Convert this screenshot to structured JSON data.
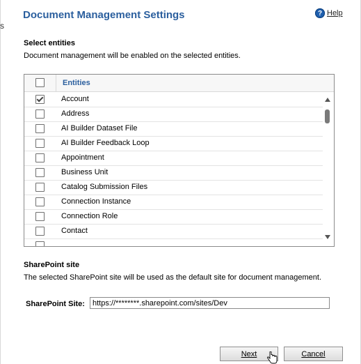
{
  "dialog": {
    "title": "Document Management Settings",
    "help_label": "Help",
    "help_icon_glyph": "?",
    "stray_char": "s"
  },
  "entities_section": {
    "heading": "Select entities",
    "description": "Document management will be enabled on the selected entities.",
    "column_header": "Entities",
    "rows": [
      {
        "label": "Account",
        "checked": true
      },
      {
        "label": "Address",
        "checked": false
      },
      {
        "label": "AI Builder Dataset File",
        "checked": false
      },
      {
        "label": "AI Builder Feedback Loop",
        "checked": false
      },
      {
        "label": "Appointment",
        "checked": false
      },
      {
        "label": "Business Unit",
        "checked": false
      },
      {
        "label": "Catalog Submission Files",
        "checked": false
      },
      {
        "label": "Connection Instance",
        "checked": false
      },
      {
        "label": "Connection Role",
        "checked": false
      },
      {
        "label": "Contact",
        "checked": false
      }
    ]
  },
  "sharepoint_section": {
    "heading": "SharePoint site",
    "description": "The selected SharePoint site will be used as the default site for document management.",
    "field_label": "SharePoint Site:",
    "field_value": "https://********.sharepoint.com/sites/Dev"
  },
  "buttons": {
    "next": "Next",
    "cancel": "Cancel"
  }
}
